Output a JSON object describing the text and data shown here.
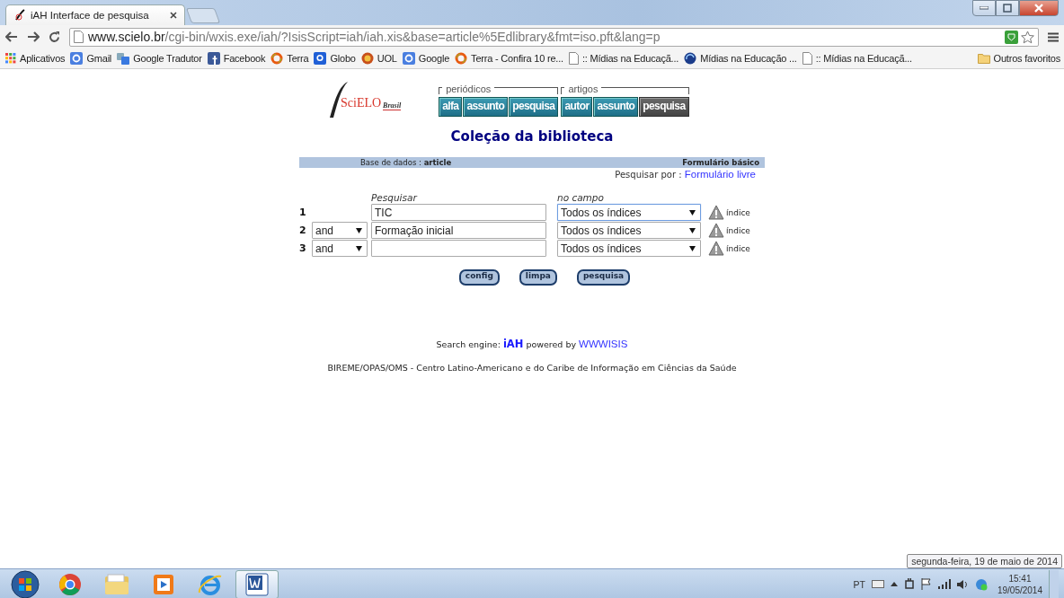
{
  "browser": {
    "tab": {
      "title": "iAH Interface de pesquisa"
    },
    "address": {
      "host": "www.scielo.br",
      "path": "/cgi-bin/wxis.exe/iah/?IsisScript=iah/iah.xis&base=article%5Edlibrary&fmt=iso.pft&lang=p"
    },
    "bookmarks": [
      {
        "label": "Aplicativos",
        "kind": "apps"
      },
      {
        "label": "Gmail",
        "kind": "google"
      },
      {
        "label": "Google Tradutor",
        "kind": "translate"
      },
      {
        "label": "Facebook",
        "kind": "facebook"
      },
      {
        "label": "Terra",
        "kind": "terra"
      },
      {
        "label": "Globo",
        "kind": "globo"
      },
      {
        "label": "UOL",
        "kind": "uol"
      },
      {
        "label": "Google",
        "kind": "google"
      },
      {
        "label": "Terra - Confira 10 re...",
        "kind": "terra"
      },
      {
        "label": ":: Mídias na Educaçã...",
        "kind": "page"
      },
      {
        "label": "Mídias na Educação ...",
        "kind": "globe"
      },
      {
        "label": ":: Mídias na Educaçã...",
        "kind": "page"
      }
    ],
    "other_bookmarks": "Outros favoritos"
  },
  "page": {
    "logo": {
      "main": "SciELO",
      "sub": "Brasil"
    },
    "nav_groups": [
      {
        "label": "periódicos",
        "buttons": [
          {
            "label": "alfa",
            "selected": false
          },
          {
            "label": "assunto",
            "selected": false
          },
          {
            "label": "pesquisa",
            "selected": false
          }
        ]
      },
      {
        "label": "artigos",
        "buttons": [
          {
            "label": "autor",
            "selected": false
          },
          {
            "label": "assunto",
            "selected": false
          },
          {
            "label": "pesquisa",
            "selected": true
          }
        ]
      }
    ],
    "title": "Coleção da biblioteca",
    "header_bar": {
      "database": "Base de dados : **article**",
      "form": "Formulário básico"
    },
    "search_by": {
      "label": "Pesquisar por :",
      "link": "Formulário livre"
    },
    "columns": [
      "Pesquisar",
      "no campo"
    ],
    "rows": [
      {
        "number": "1",
        "value": "TIC",
        "field": "Todos os índices",
        "focused": true,
        "index_link": "índice"
      },
      {
        "number": "2",
        "operator": "and",
        "value": "Formação inicial",
        "field": "Todos os índices",
        "focused": false,
        "index_link": "índice"
      },
      {
        "number": "3",
        "operator": "and",
        "field": "Todos os índices",
        "focused": false,
        "index_link": "índice"
      }
    ],
    "buttons": [
      "config",
      "limpa",
      "pesquisa"
    ],
    "footer": {
      "engine_prefix": "Search engine:",
      "engine": "iAH",
      "powered": "powered by",
      "link": "WWWISIS",
      "institution": "BIREME/OPAS/OMS - Centro Latino-Americano e do Caribe de Informação em Ciências da Saúde"
    }
  },
  "taskbar": {
    "apps": [
      {
        "kind": "chrome",
        "active": false
      },
      {
        "kind": "folder",
        "active": false
      },
      {
        "kind": "media",
        "active": false
      },
      {
        "kind": "ie",
        "active": false
      },
      {
        "kind": "word",
        "active": true
      }
    ],
    "language": "PT",
    "time": "15:41",
    "date": "19/05/2014",
    "tooltip": "segunda-feira, 19 de maio de 2014"
  }
}
